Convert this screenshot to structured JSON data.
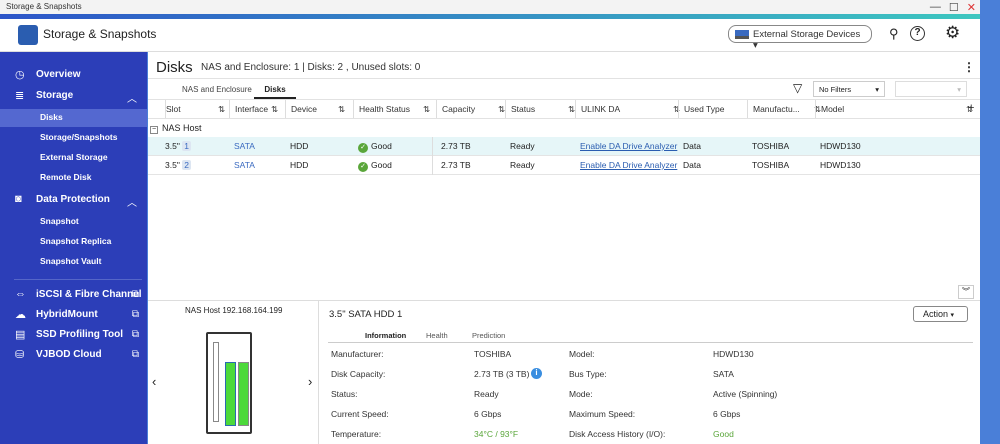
{
  "window": {
    "title": "Storage & Snapshots",
    "controls": [
      "—",
      "☐",
      "✕"
    ]
  },
  "header": {
    "app_title": "Storage & Snapshots",
    "external_devices": "External Storage Devices"
  },
  "sidebar": {
    "items": [
      {
        "label": "Overview",
        "type": "top"
      },
      {
        "label": "Storage",
        "type": "top"
      },
      {
        "label": "Disks",
        "type": "sub",
        "selected": true
      },
      {
        "label": "Storage/Snapshots",
        "type": "sub"
      },
      {
        "label": "External Storage",
        "type": "sub"
      },
      {
        "label": "Remote Disk",
        "type": "sub"
      },
      {
        "label": "Data Protection",
        "type": "top"
      },
      {
        "label": "Snapshot",
        "type": "sub"
      },
      {
        "label": "Snapshot Replica",
        "type": "sub"
      },
      {
        "label": "Snapshot Vault",
        "type": "sub"
      },
      {
        "label": "iSCSI & Fibre Channel",
        "type": "ext"
      },
      {
        "label": "HybridMount",
        "type": "ext"
      },
      {
        "label": "SSD Profiling Tool",
        "type": "ext"
      },
      {
        "label": "VJBOD Cloud",
        "type": "ext"
      }
    ]
  },
  "main": {
    "title": "Disks",
    "summary": "NAS and Enclosure: 1 | Disks: 2 , Unused slots: 0",
    "tabs": [
      "NAS and Enclosure",
      "Disks"
    ],
    "active_tab": "Disks",
    "filter": "No Filters",
    "columns": [
      "Slot",
      "Interface",
      "Device",
      "Health Status",
      "Capacity",
      "Status",
      "ULINK DA",
      "Used Type",
      "Manufactu...",
      "Model"
    ],
    "group": "NAS Host",
    "rows": [
      {
        "slot": "3.5\"",
        "num": "1",
        "interface": "SATA",
        "device": "HDD",
        "health": "Good",
        "capacity": "2.73 TB",
        "status": "Ready",
        "ulink": "Enable DA Drive Analyzer",
        "used": "Data",
        "manufacturer": "TOSHIBA",
        "model": "HDWD130"
      },
      {
        "slot": "3.5\"",
        "num": "2",
        "interface": "SATA",
        "device": "HDD",
        "health": "Good",
        "capacity": "2.73 TB",
        "status": "Ready",
        "ulink": "Enable DA Drive Analyzer",
        "used": "Data",
        "manufacturer": "TOSHIBA",
        "model": "HDWD130"
      }
    ]
  },
  "detail": {
    "host": "NAS Host",
    "ip": "192.168.164.199",
    "disk_title": "3.5\" SATA HDD 1",
    "action": "Action",
    "tabs": [
      "Information",
      "Health",
      "Prediction"
    ],
    "fields": [
      {
        "l": "Manufacturer:",
        "v": "TOSHIBA",
        "l2": "Model:",
        "v2": "HDWD130"
      },
      {
        "l": "Disk Capacity:",
        "v": "2.73 TB (3 TB)",
        "l2": "Bus Type:",
        "v2": "SATA"
      },
      {
        "l": "Status:",
        "v": "Ready",
        "l2": "Mode:",
        "v2": "Active (Spinning)"
      },
      {
        "l": "Current Speed:",
        "v": "6 Gbps",
        "l2": "Maximum Speed:",
        "v2": "6 Gbps"
      },
      {
        "l": "Temperature:",
        "v": "34°C / 93°F",
        "l2": "Disk Access History (I/O):",
        "v2": "Good"
      }
    ]
  },
  "colors": {
    "sidebar": "#2c3eb8",
    "accent": "#2a5db0",
    "good": "#5aa63a",
    "selected_row": "#e6f6f8"
  }
}
